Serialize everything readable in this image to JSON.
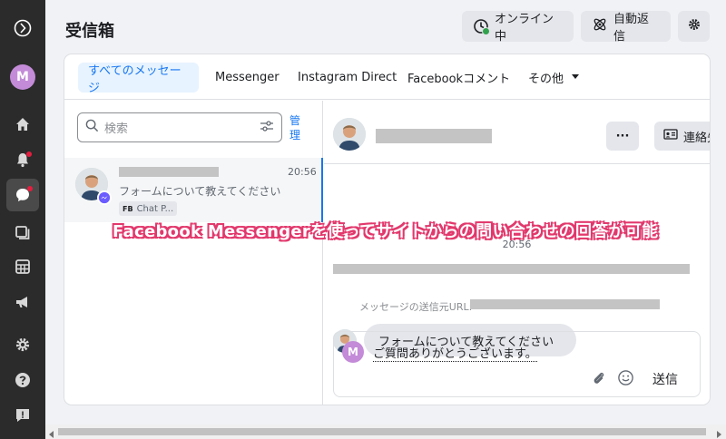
{
  "header": {
    "title": "受信箱",
    "status_label": "オンライン中",
    "auto_reply_label": "自動返信"
  },
  "tabs": [
    {
      "label": "すべてのメッセージ"
    },
    {
      "label": "Messenger"
    },
    {
      "label": "Instagram Direct"
    },
    {
      "label": "Facebookコメント"
    },
    {
      "label": "その他"
    }
  ],
  "search": {
    "placeholder": "検索",
    "manage_label": "管理"
  },
  "conversation": {
    "time": "20:56",
    "preview": "フォームについて教えてください",
    "tag_prefix": "FB",
    "tag": "Chat P..."
  },
  "chat": {
    "more_label": "···",
    "view_contact_label": "連絡先を見る",
    "timestamp": "20:56",
    "source_url_label": "メッセージの送信元URL:",
    "message": "フォームについて教えてください",
    "composer_text": "ご質問ありがとうございます。",
    "composer_avatar": "M",
    "send_label": "送信"
  },
  "sidebar": {
    "avatar_letter": "M"
  },
  "caption": "Facebook Messengerを使ってサイトからの問い合わせの回答が可能",
  "colors": {
    "accent": "#1877f2",
    "rail": "#2b2b2b",
    "caption_outline": "#e23a6e",
    "avatar": "#c38bd8",
    "online": "#31a24c"
  }
}
